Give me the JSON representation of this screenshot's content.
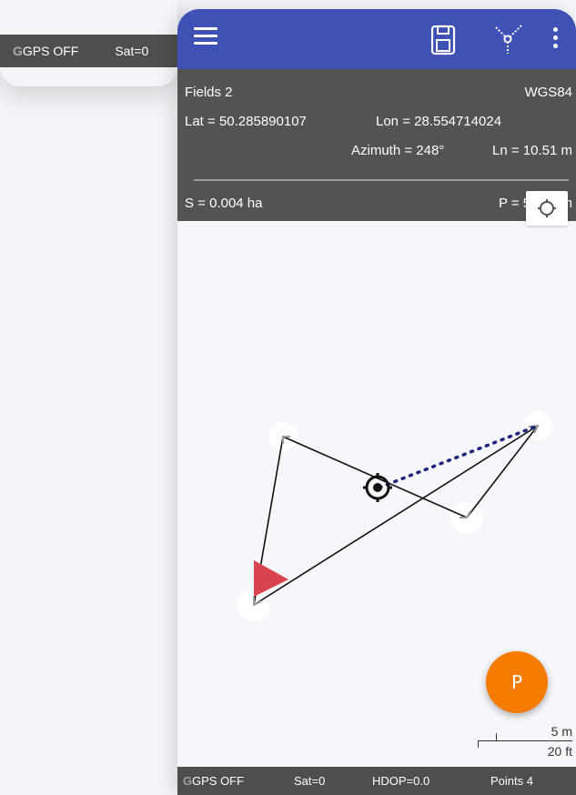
{
  "background_window": {
    "gps_status": "GPS OFF",
    "sat": "Sat=0",
    "logo_letter": "G"
  },
  "toolbar": {
    "menu_icon": "hamburger-icon",
    "save_icon": "save-icon",
    "split_icon": "split-point-icon",
    "more_icon": "more-vert-icon",
    "color": "#3f51b5"
  },
  "info": {
    "field_name": "Fields 2",
    "datum": "WGS84",
    "lat": "Lat = 50.285890107",
    "lon": "Lon = 28.554714024",
    "azimuth": "Azimuth = 248°",
    "length": "Ln = 10.51 m",
    "area": "S = 0.004 ha",
    "perimeter": "P = 51.55 m"
  },
  "map": {
    "locate_icon": "crosshair-icon",
    "start_flag_icon": "flag-icon",
    "fab_label": "P",
    "fab_color": "#f57c00",
    "scale_metric": "5 m",
    "scale_imperial": "20 ft"
  },
  "status": {
    "logo_letter": "G",
    "gps": "GPS OFF",
    "sat": "Sat=0",
    "hdop": "HDOP=0.0",
    "points": "Points 4"
  }
}
